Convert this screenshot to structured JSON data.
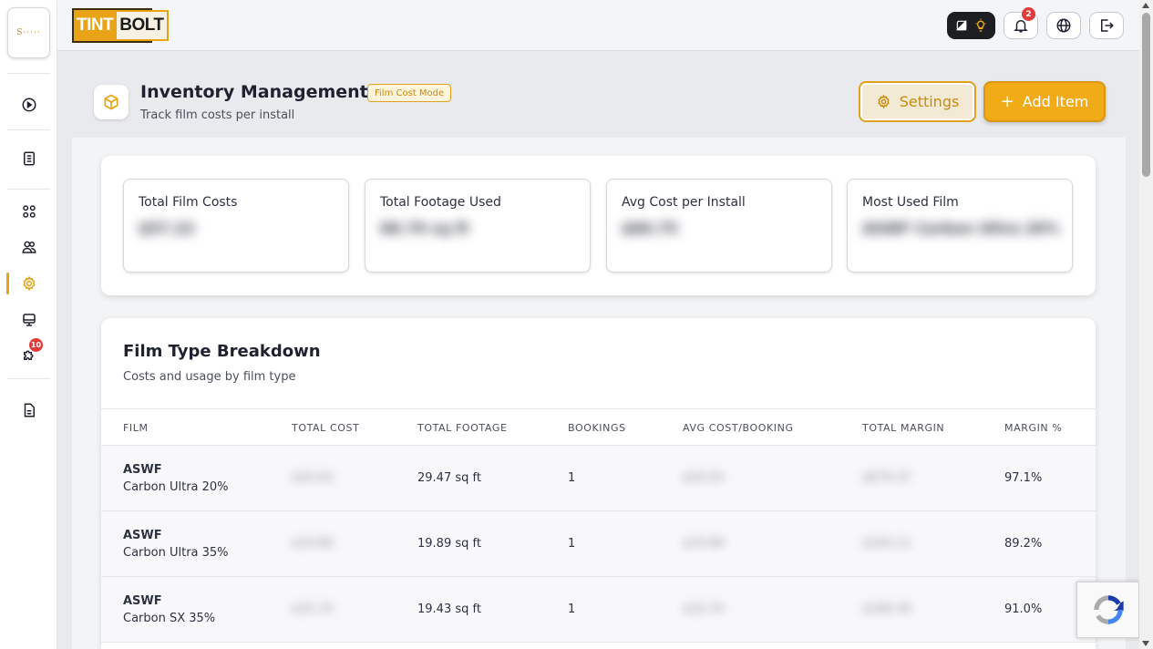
{
  "sidebar": {
    "brand_logo_text": "S·····",
    "items": [
      {
        "name": "dashboard-play-icon"
      },
      {
        "name": "clipboard-icon"
      },
      {
        "name": "apps-grid-icon"
      },
      {
        "name": "users-icon"
      },
      {
        "name": "settings-gear-icon",
        "active": true
      },
      {
        "name": "monitor-icon"
      },
      {
        "name": "puzzle-icon",
        "badge": "10"
      },
      {
        "name": "document-icon"
      }
    ]
  },
  "topbar": {
    "logo_tint": "TINT",
    "logo_bolt": "BOLT",
    "notification_count": "2",
    "accent_color": "#e8a317"
  },
  "header": {
    "title": "Inventory Management",
    "mode_badge": "Film Cost Mode",
    "subtitle": "Track film costs per install",
    "settings_label": "Settings",
    "add_item_label": "Add Item",
    "add_item_icon": "+"
  },
  "stats": [
    {
      "label": "Total Film Costs",
      "value": "$57.22"
    },
    {
      "label": "Total Footage Used",
      "value": "68.79 sq ft"
    },
    {
      "label": "Avg Cost per Install",
      "value": "$60.75"
    },
    {
      "label": "Most Used Film",
      "value": "ASWF Carbon Ultra 20%"
    }
  ],
  "film_table": {
    "title": "Film Type Breakdown",
    "subtitle": "Costs and usage by film type",
    "columns": [
      "FILM",
      "TOTAL COST",
      "TOTAL FOOTAGE",
      "BOOKINGS",
      "AVG COST/BOOKING",
      "TOTAL MARGIN",
      "MARGIN %"
    ],
    "rows": [
      {
        "brand": "ASWF",
        "film": "Carbon Ultra 20%",
        "total_cost": "$20.63",
        "total_footage": "29.47 sq ft",
        "bookings": "1",
        "avg_cost": "$20.63",
        "total_margin": "$679.37",
        "margin_pct": "97.1%"
      },
      {
        "brand": "ASWF",
        "film": "Carbon Ultra 35%",
        "total_cost": "$19.89",
        "total_footage": "19.89 sq ft",
        "bookings": "1",
        "avg_cost": "$19.89",
        "total_margin": "$164.11",
        "margin_pct": "89.2%"
      },
      {
        "brand": "ASWF",
        "film": "Carbon SX 35%",
        "total_cost": "$16.70",
        "total_footage": "19.43 sq ft",
        "bookings": "1",
        "avg_cost": "$16.70",
        "total_margin": "$168.30",
        "margin_pct": "91.0%"
      }
    ]
  }
}
